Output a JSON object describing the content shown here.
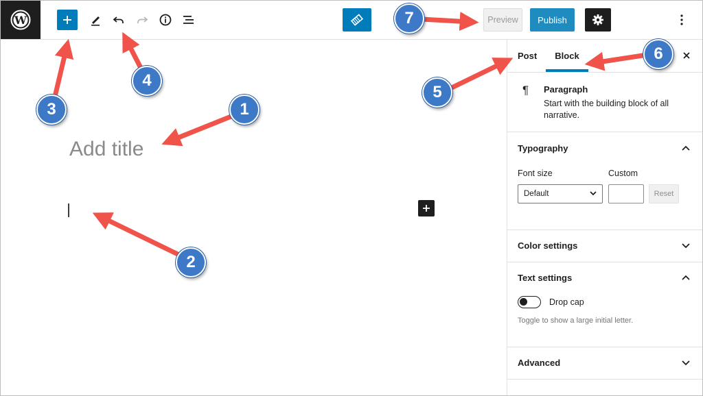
{
  "toolbar": {
    "wordpress_logo_icon": "wordpress-logo-icon",
    "inserter_icon": "plus-icon",
    "tools": [
      {
        "name": "pencil-icon"
      },
      {
        "name": "undo-icon"
      },
      {
        "name": "redo-icon"
      },
      {
        "name": "info-icon"
      },
      {
        "name": "list-view-icon"
      }
    ],
    "preview_label": "Preview",
    "publish_label": "Publish",
    "settings_icon": "gear-icon",
    "more_icon": "more-vertical-icon"
  },
  "editor": {
    "title_placeholder": "Add title",
    "add_block_icon": "plus-icon"
  },
  "sidebar": {
    "tabs": [
      {
        "label": "Post",
        "active": false
      },
      {
        "label": "Block",
        "active": true
      }
    ],
    "close_icon": "close-icon",
    "block_card": {
      "icon": "pilcrow-icon",
      "name": "Paragraph",
      "description": "Start with the building block of all narrative."
    },
    "typography": {
      "title": "Typography",
      "font_size_label": "Font size",
      "custom_label": "Custom",
      "font_size_value": "Default",
      "reset_label": "Reset"
    },
    "color_settings": {
      "title": "Color settings"
    },
    "text_settings": {
      "title": "Text settings",
      "drop_cap_label": "Drop cap",
      "drop_cap_on": false,
      "help": "Toggle to show a large initial letter."
    },
    "advanced": {
      "title": "Advanced"
    }
  },
  "annotations": {
    "badges": [
      "1",
      "2",
      "3",
      "4",
      "5",
      "6",
      "7"
    ]
  },
  "colors": {
    "accent": "#007cba",
    "publish": "#1e8cbe",
    "dark": "#1e1e1e",
    "arrow": "#f0534a",
    "badge": "#3d79c7"
  }
}
